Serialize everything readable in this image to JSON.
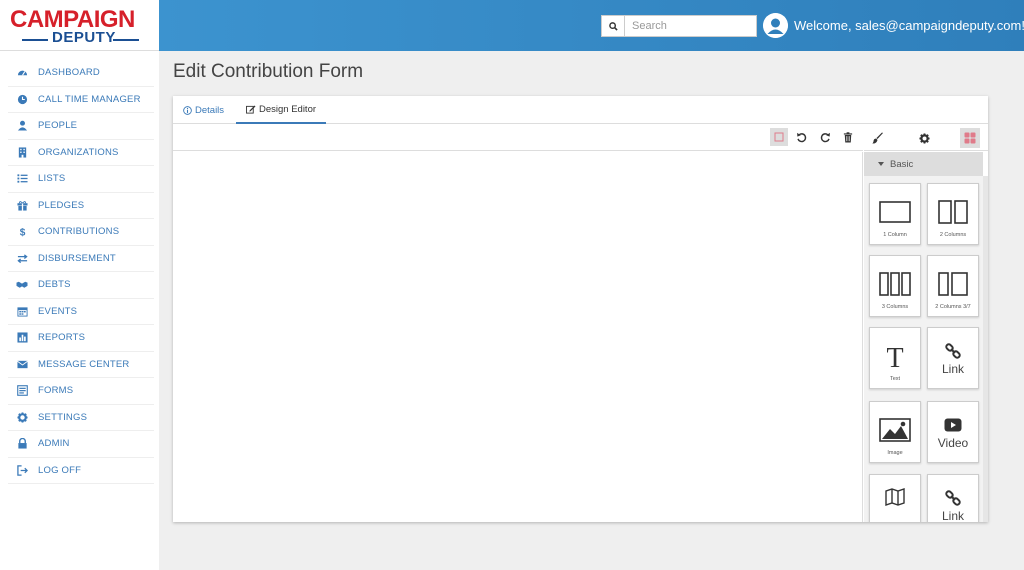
{
  "logo": {
    "top": "CAMPAIGN",
    "bottom": "DEPUTY"
  },
  "header": {
    "search_placeholder": "Search",
    "welcome": "Welcome, sales@campaigndeputy.com!▾"
  },
  "sidebar": {
    "items": [
      {
        "label": "DASHBOARD",
        "icon": "dashboard-icon"
      },
      {
        "label": "CALL TIME MANAGER",
        "icon": "clock-icon"
      },
      {
        "label": "PEOPLE",
        "icon": "user-icon"
      },
      {
        "label": "ORGANIZATIONS",
        "icon": "building-icon"
      },
      {
        "label": "LISTS",
        "icon": "list-icon"
      },
      {
        "label": "PLEDGES",
        "icon": "gift-icon"
      },
      {
        "label": "CONTRIBUTIONS",
        "icon": "dollar-icon"
      },
      {
        "label": "DISBURSEMENT",
        "icon": "exchange-icon"
      },
      {
        "label": "DEBTS",
        "icon": "handshake-icon"
      },
      {
        "label": "EVENTS",
        "icon": "calendar-icon"
      },
      {
        "label": "REPORTS",
        "icon": "chart-icon"
      },
      {
        "label": "MESSAGE CENTER",
        "icon": "envelope-icon"
      },
      {
        "label": "FORMS",
        "icon": "form-icon"
      },
      {
        "label": "SETTINGS",
        "icon": "gear-icon"
      },
      {
        "label": "ADMIN",
        "icon": "lock-icon"
      },
      {
        "label": "LOG OFF",
        "icon": "logout-icon"
      }
    ]
  },
  "page": {
    "title": "Edit Contribution Form"
  },
  "tabs": {
    "details": "Details",
    "design": "Design Editor"
  },
  "panel": {
    "category": "Basic",
    "blocks": [
      {
        "label": "1 Column",
        "icon": "one-column-icon"
      },
      {
        "label": "2 Columns",
        "icon": "two-columns-icon"
      },
      {
        "label": "3 Columns",
        "icon": "three-columns-icon"
      },
      {
        "label": "2 Columns 3/7",
        "icon": "two-columns-37-icon"
      },
      {
        "label": "Text",
        "icon": "text-icon"
      },
      {
        "label": "Link",
        "icon": "link-icon"
      },
      {
        "label": "Image",
        "icon": "image-icon"
      },
      {
        "label": "Video",
        "icon": "video-icon"
      },
      {
        "label": "",
        "icon": "map-icon"
      },
      {
        "label": "Link",
        "icon": "link-icon"
      }
    ]
  },
  "colors": {
    "accent": "#3b7ab8",
    "brand_red": "#d6202a",
    "brand_blue": "#1b4f93",
    "topbar": "#3489c6"
  }
}
